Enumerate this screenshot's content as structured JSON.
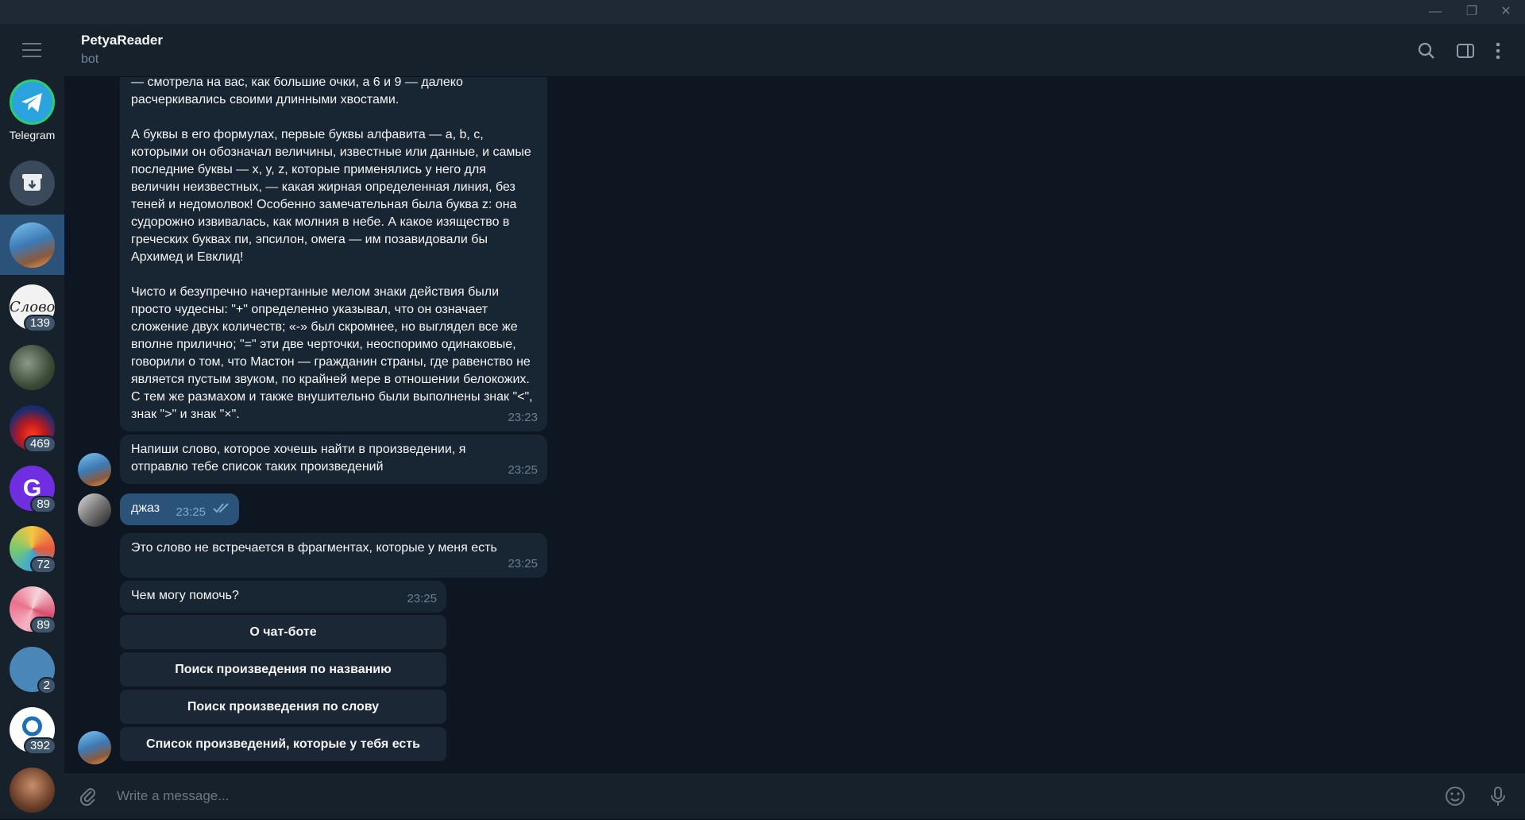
{
  "window": {
    "minimize": "—",
    "restore": "❐",
    "close": "✕"
  },
  "sidebar": {
    "items": [
      {
        "name": "Telegram",
        "badge": ""
      },
      {
        "name": "archive",
        "badge": ""
      },
      {
        "name": "petyareader",
        "badge": ""
      },
      {
        "name": "slovo",
        "badge": "139"
      },
      {
        "name": "forest",
        "badge": ""
      },
      {
        "name": "fire",
        "badge": "469"
      },
      {
        "name": "g-channel",
        "badge": "89"
      },
      {
        "name": "colorful",
        "badge": "72"
      },
      {
        "name": "pink-fan",
        "badge": "89"
      },
      {
        "name": "hab",
        "badge": "2"
      },
      {
        "name": "rosatom",
        "badge": "392"
      },
      {
        "name": "bottom-avatar",
        "badge": ""
      }
    ]
  },
  "header": {
    "title": "PetyaReader",
    "subtitle": "bot"
  },
  "messages": {
    "long_text_p1": "— смотрела на вас, как большие очки, а 6 и 9 — далеко расчеркивались своими длинными хвостами.",
    "long_text_p2": "А буквы в его формулах, первые буквы алфавита — a, b, c, которыми он обозначал величины, известные или данные, и самые последние буквы — x, y, z, которые применялись у него для величин неизвестных, — какая жирная определенная линия, без теней и недомолвок! Особенно замечательная была буква z: она судорожно извивалась, как молния в небе. А какое изящество в греческих буквах пи, эпсилон, омега — им позавидовали бы Архимед и Евклид!",
    "long_text_p3": "Чисто и безупречно начертанные мелом знаки действия были просто чудесны: \"+\" определенно указывал, что он означает сложение двух количеств; «-» был скромнее, но выглядел все же вполне прилично; \"=\" эти две черточки, неоспоримо одинаковые, говорили о том, что Мастон — гражданин страны, где равенство не является пустым звуком, по крайней мере в отношении белокожих. С тем же размахом и также внушительно были выполнены знак \"<\", знак \">\" и знак \"×\".",
    "long_time": "23:23",
    "prompt_text": "Напиши слово, которое хочешь найти в произведении, я отправлю тебе список таких произведений",
    "prompt_time": "23:25",
    "user_text": "джаз",
    "user_time": "23:25",
    "notfound_text": "Это слово не встречается в фрагментах, которые у меня есть",
    "notfound_time": "23:25",
    "help_text": "Чем могу помочь?",
    "help_time": "23:25"
  },
  "keyboard": {
    "about": "О чат-боте",
    "by_title": "Поиск произведения по названию",
    "by_word": "Поиск произведения по слову",
    "list": "Список произведений, которые у тебя есть"
  },
  "composer": {
    "placeholder": "Write a message..."
  },
  "colors": {
    "bg": "#0e1621",
    "panel": "#17212b",
    "bubble_in": "#182533",
    "bubble_out": "#2b5278",
    "accent": "#5eb5f7"
  }
}
